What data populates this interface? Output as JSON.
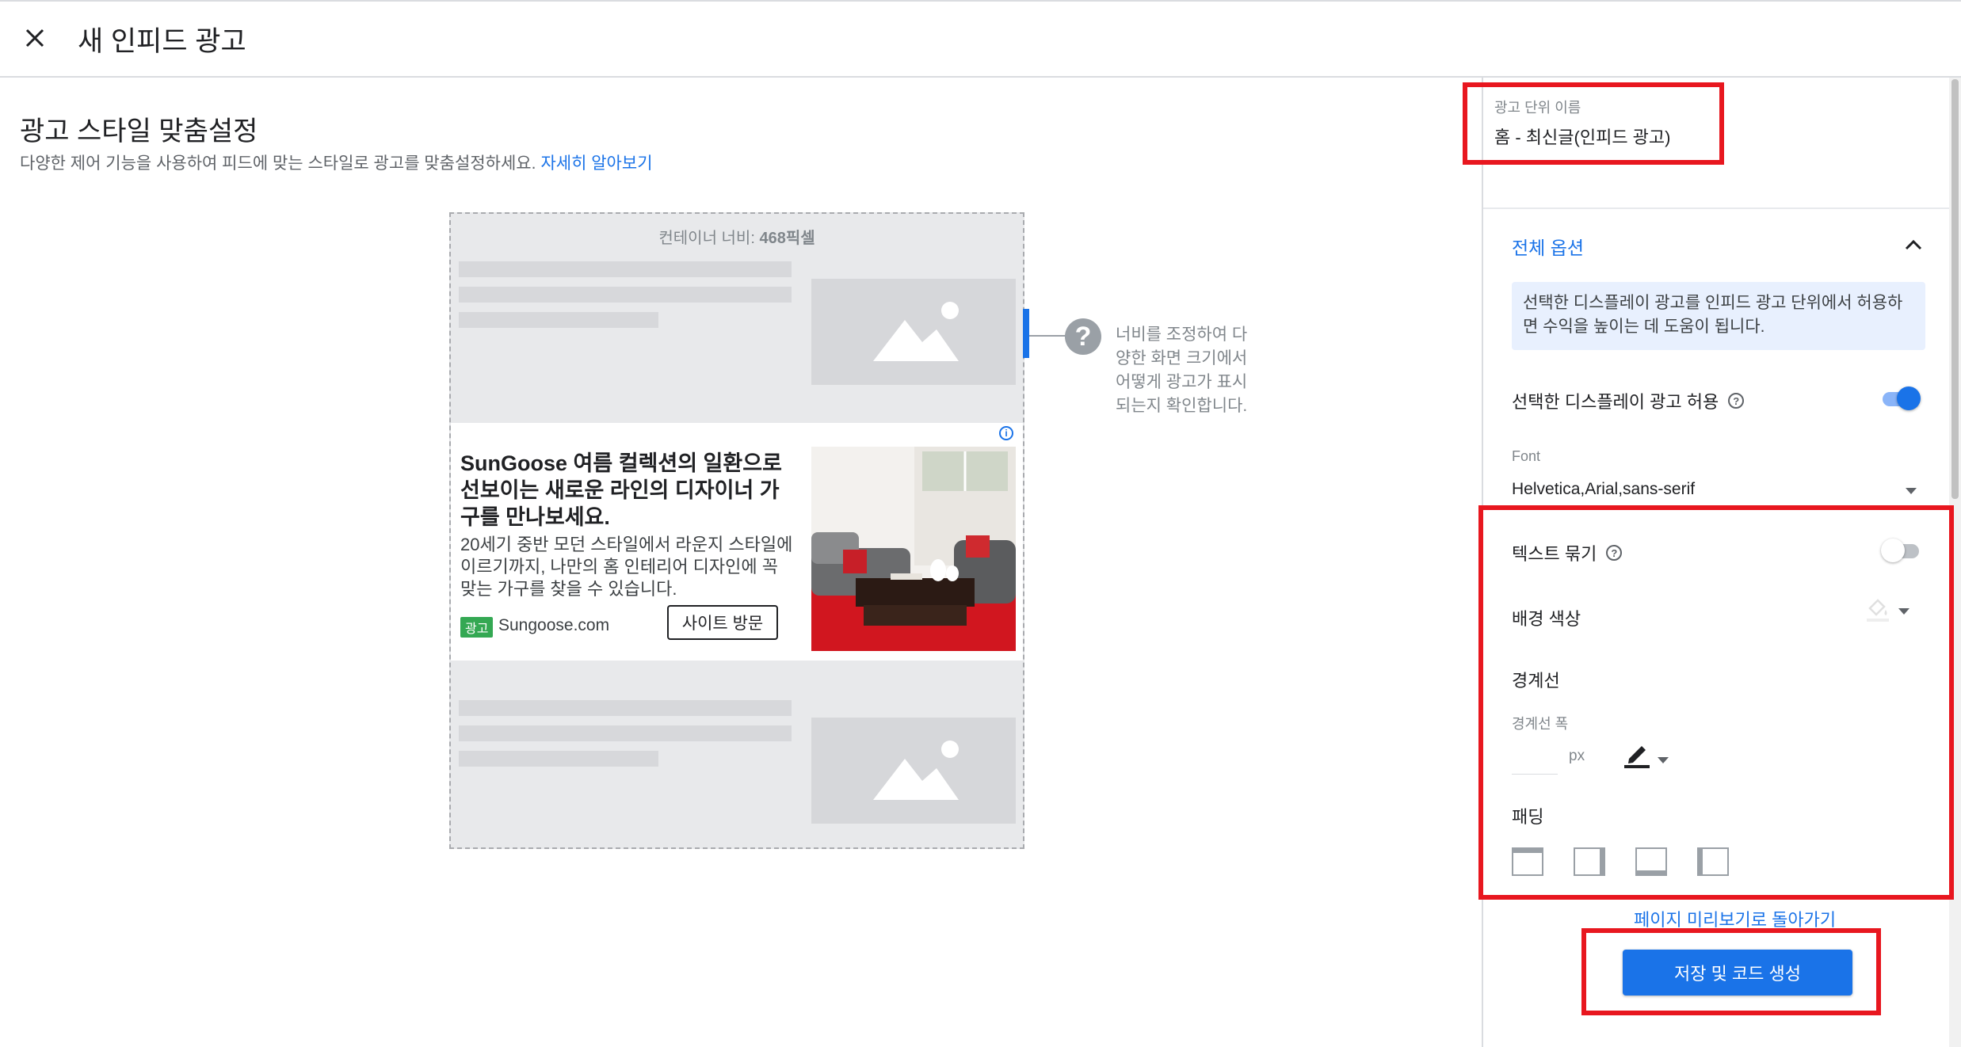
{
  "header": {
    "title": "새 인피드 광고"
  },
  "main": {
    "title": "광고 스타일 맞춤설정",
    "subtitle": "다양한 제어 기능을 사용하여 피드에 맞는 스타일로 광고를 맞춤설정하세요.",
    "learn_more": "자세히 알아보기",
    "container_label_prefix": "컨테이너 너비: ",
    "container_width": "468픽셀",
    "ad": {
      "headline": "SunGoose 여름 컬렉션의 일환으로 선보이는 새로운 라인의 디자이너 가구를 만나보세요.",
      "body": "20세기 중반 모던 스타일에서 라운지 스타일에 이르기까지, 나만의 홈 인테리어 디자인에 꼭 맞는 가구를 찾을 수 있습니다.",
      "badge": "광고",
      "domain": "Sungoose.com",
      "cta": "사이트 방문",
      "info": "i"
    },
    "width_help": "너비를 조정하여 다양한 화면 크기에서 어떻게 광고가 표시되는지 확인합니다."
  },
  "panel": {
    "unit_name_label": "광고 단위 이름",
    "unit_name_value": "홈 - 최신글(인피드 광고)",
    "section_title": "전체 옵션",
    "info_text": "선택한 디스플레이 광고를 인피드 광고 단위에서 허용하면 수익을 높이는 데 도움이 됩니다.",
    "allow_display_label": "선택한 디스플레이 광고 허용",
    "allow_display_on": true,
    "font_label": "Font",
    "font_value": "Helvetica,Arial,sans-serif",
    "text_wrap_label": "텍스트 묶기",
    "text_wrap_on": false,
    "bg_color_label": "배경 색상",
    "border_label": "경계선",
    "border_width_label": "경계선 폭",
    "border_width_value": "",
    "border_width_unit": "px",
    "padding_label": "패딩",
    "back_link": "페이지 미리보기로 돌아가기",
    "save_button": "저장 및 코드 생성"
  },
  "colors": {
    "accent": "#1a73e8",
    "highlight": "#e8171f",
    "badge": "#34a853"
  }
}
